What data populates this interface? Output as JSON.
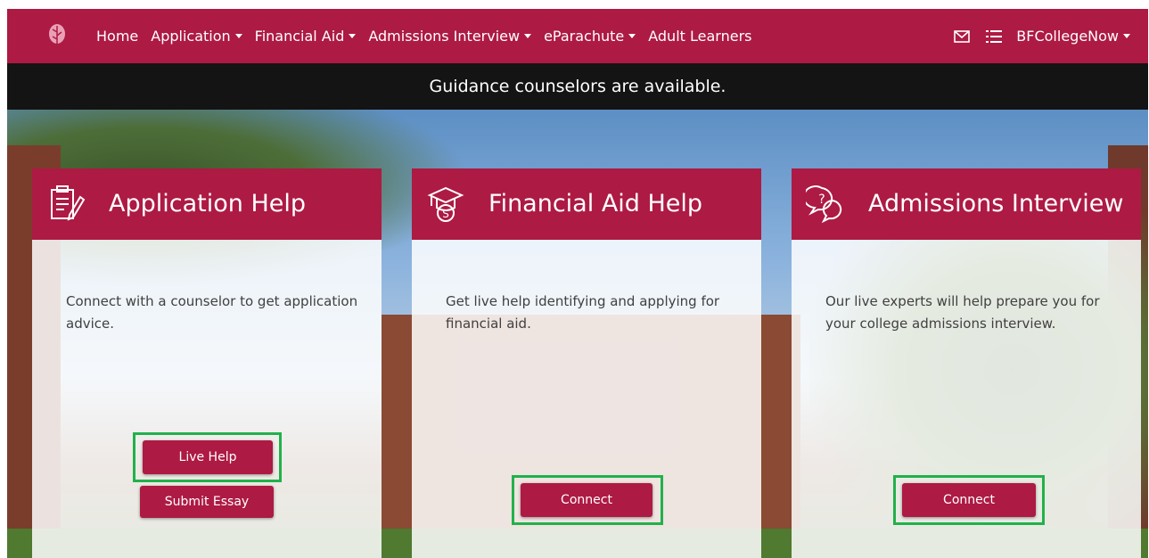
{
  "nav": {
    "logo": "leaf-logo",
    "links": [
      {
        "label": "Home",
        "dropdown": false
      },
      {
        "label": "Application",
        "dropdown": true
      },
      {
        "label": "Financial Aid",
        "dropdown": true
      },
      {
        "label": "Admissions Interview",
        "dropdown": true
      },
      {
        "label": "eParachute",
        "dropdown": true
      },
      {
        "label": "Adult Learners",
        "dropdown": false
      }
    ],
    "icons": [
      "mail-icon",
      "list-icon"
    ],
    "user_menu": "BFCollegeNow"
  },
  "announcement": "Guidance counselors are available.",
  "cards": [
    {
      "icon": "document-pen-icon",
      "title": "Application Help",
      "body": "Connect with a counselor to get application advice.",
      "buttons": [
        "Live Help",
        "Submit Essay"
      ]
    },
    {
      "icon": "graduation-money-icon",
      "title": "Financial Aid Help",
      "body": "Get live help identifying and applying for financial aid.",
      "buttons": [
        "Connect"
      ]
    },
    {
      "icon": "question-chat-icon",
      "title": "Admissions Interview",
      "body": "Our live experts will help prepare you for your college admissions interview.",
      "buttons": [
        "Connect"
      ]
    }
  ],
  "colors": {
    "brand": "#ad1a43",
    "announce_bg": "#141414",
    "highlight": "#21b14b"
  }
}
